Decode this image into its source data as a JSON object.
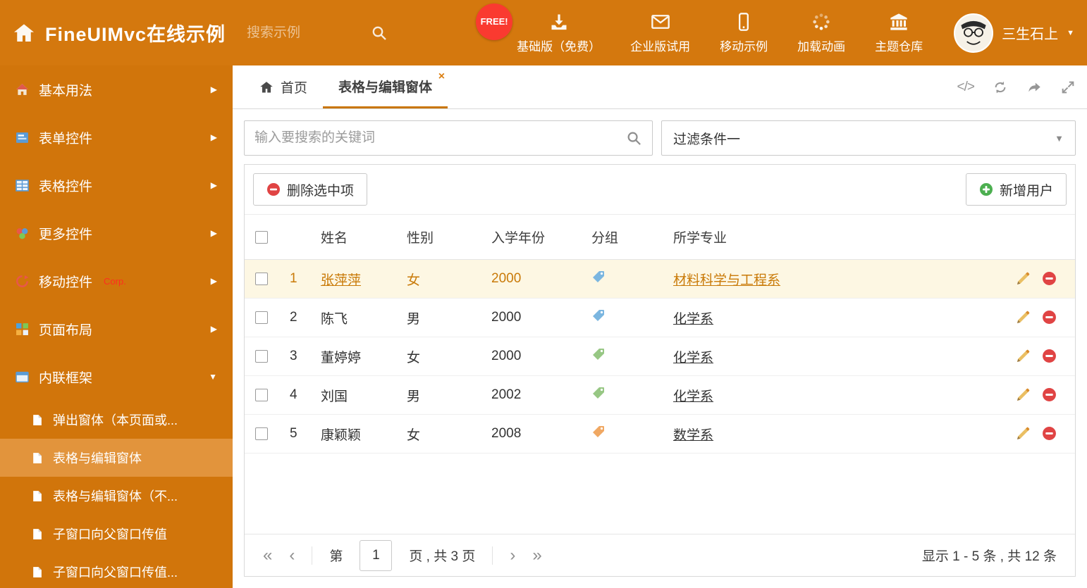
{
  "colors": {
    "header_bg": "#d4780e",
    "sidebar_bg": "#d1750b",
    "sidebar_selected_bg": "#e2943c",
    "accent": "#c97608",
    "selected_row_bg": "#fdf7e3",
    "selected_row_text": "#c97a08",
    "free_badge_bg": "#fa3a30",
    "delete_icon": "#e04444",
    "add_icon": "#4caf50"
  },
  "icons": {
    "chevron_right": "▶",
    "chevron_down": "▼",
    "caret_down": "▼",
    "close": "×",
    "code": "</>",
    "first": "«",
    "prev": "‹",
    "next": "›",
    "last": "»"
  },
  "header": {
    "title": "FineUIMvc在线示例",
    "search_placeholder": "搜索示例",
    "free_badge": "FREE!",
    "nav_items": [
      {
        "label": "基础版（免费）",
        "icon": "download-icon"
      },
      {
        "label": "企业版试用",
        "icon": "envelope-icon"
      },
      {
        "label": "移动示例",
        "icon": "mobile-icon"
      },
      {
        "label": "加载动画",
        "icon": "spinner-icon"
      },
      {
        "label": "主题仓库",
        "icon": "bank-icon"
      }
    ],
    "user": {
      "name": "三生石上"
    }
  },
  "sidebar": {
    "items": [
      {
        "label": "基本用法"
      },
      {
        "label": "表单控件"
      },
      {
        "label": "表格控件"
      },
      {
        "label": "更多控件"
      },
      {
        "label": "移动控件",
        "badge": "Corp."
      },
      {
        "label": "页面布局"
      },
      {
        "label": "内联框架",
        "expanded": true
      }
    ],
    "subitems": [
      {
        "label": "弹出窗体（本页面或..."
      },
      {
        "label": "表格与编辑窗体",
        "selected": true
      },
      {
        "label": "表格与编辑窗体（不..."
      },
      {
        "label": "子窗口向父窗口传值"
      },
      {
        "label": "子窗口向父窗口传值..."
      }
    ]
  },
  "tabs": {
    "home": "首页",
    "active": "表格与编辑窗体"
  },
  "filter": {
    "search_placeholder": "输入要搜索的关键词",
    "dropdown_value": "过滤条件一"
  },
  "toolbar": {
    "delete_label": "删除选中项",
    "add_label": "新增用户"
  },
  "table": {
    "columns": [
      "姓名",
      "性别",
      "入学年份",
      "分组",
      "所学专业"
    ],
    "rows": [
      {
        "num": "1",
        "name": "张萍萍",
        "gender": "女",
        "year": "2000",
        "major": "材料科学与工程系",
        "tag_color": "#7bb6e0",
        "selected": true
      },
      {
        "num": "2",
        "name": "陈飞",
        "gender": "男",
        "year": "2000",
        "major": "化学系",
        "tag_color": "#7bb6e0"
      },
      {
        "num": "3",
        "name": "董婷婷",
        "gender": "女",
        "year": "2000",
        "major": "化学系",
        "tag_color": "#97c784"
      },
      {
        "num": "4",
        "name": "刘国",
        "gender": "男",
        "year": "2002",
        "major": "化学系",
        "tag_color": "#97c784"
      },
      {
        "num": "5",
        "name": "康颖颖",
        "gender": "女",
        "year": "2008",
        "major": "数学系",
        "tag_color": "#f0a863"
      }
    ]
  },
  "pagination": {
    "label_pre": "第",
    "current": "1",
    "label_post": "页 , 共 3 页",
    "summary": "显示 1 - 5 条 , 共 12 条"
  }
}
